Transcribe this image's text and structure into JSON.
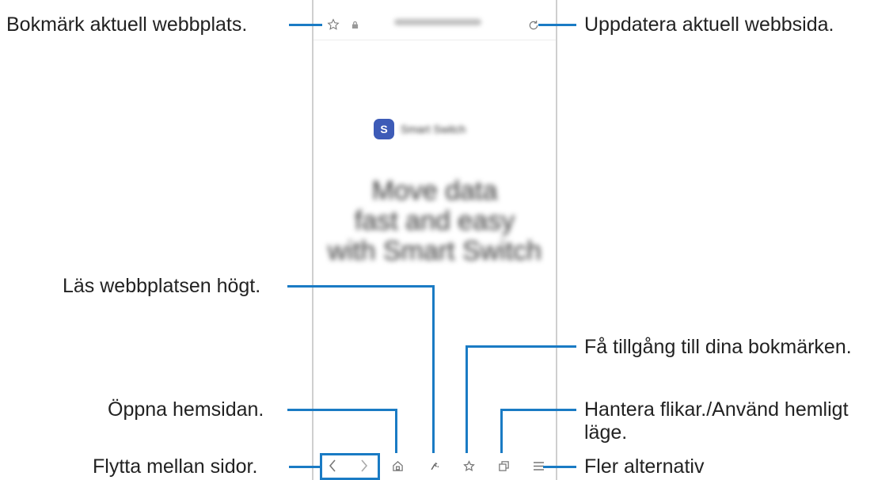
{
  "callouts": {
    "bookmark_site": "Bokmärk aktuell webbplats.",
    "refresh_page": "Uppdatera aktuell webbsida.",
    "read_aloud": "Läs webbplatsen högt.",
    "bookmarks": "Få tillgång till dina bokmärken.",
    "home": "Öppna hemsidan.",
    "tabs_line1": "Hantera flikar./Använd hemligt",
    "tabs_line2": "läge.",
    "navigate": "Flytta mellan sidor.",
    "more_options": "Fler alternativ"
  },
  "page": {
    "app_name": "Smart Switch",
    "headline": [
      "Move data",
      "fast and easy",
      "with Smart Switch"
    ]
  },
  "icons": {
    "bookmark_add": "star-outline-icon",
    "lock": "lock-icon",
    "refresh": "refresh-icon",
    "back": "chevron-left-icon",
    "forward": "chevron-right-icon",
    "home": "home-icon",
    "read_aloud": "read-aloud-icon",
    "bookmarks": "star-outline-icon",
    "tabs": "tabs-icon",
    "menu": "menu-icon"
  },
  "colors": {
    "accent": "#1a7bc4",
    "app_logo": "#3d5bb7"
  }
}
